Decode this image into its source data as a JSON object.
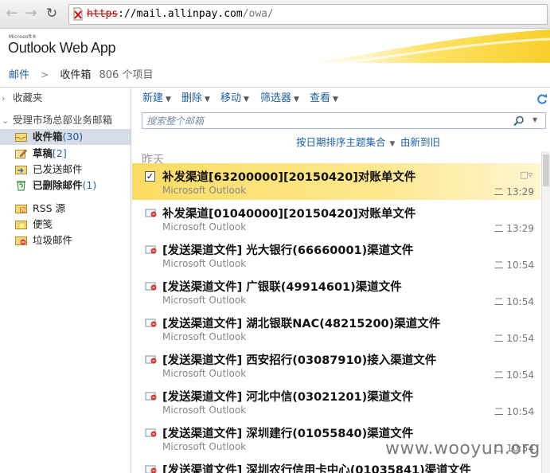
{
  "browser": {
    "url_scheme": "https",
    "url_host": "://mail.allinpay.com",
    "url_path": "/owa/"
  },
  "header": {
    "brand_small": "Microsoft®",
    "brand": "Outlook Web App"
  },
  "breadcrumb": {
    "root": "邮件",
    "current": "收件箱",
    "count": "806 个项目"
  },
  "nav": {
    "favorites": "收藏夹",
    "mailbox": "受理市场总部业务邮箱",
    "folders": [
      {
        "name": "收件箱",
        "count": "(30)"
      },
      {
        "name": "草稿",
        "count": "[2]"
      },
      {
        "name": "已发送邮件",
        "count": ""
      },
      {
        "name": "已删除邮件",
        "count": "(1)"
      },
      {
        "name": "RSS 源",
        "count": ""
      },
      {
        "name": "便笺",
        "count": ""
      },
      {
        "name": "垃圾邮件",
        "count": ""
      }
    ]
  },
  "toolbar": {
    "new": "新建",
    "delete": "删除",
    "move": "移动",
    "filter": "筛选器",
    "view": "查看"
  },
  "search": {
    "placeholder": "搜索整个邮箱"
  },
  "sort": {
    "arrange": "按日期排序主题集合",
    "order": "由新到旧"
  },
  "list": {
    "group": "昨天",
    "messages": [
      {
        "subject": "补发渠道[63200000][20150420]对账单文件",
        "sender": "Microsoft Outlook",
        "time": "二 13:29",
        "selected": true
      },
      {
        "subject": "补发渠道[01040000][20150420]对账单文件",
        "sender": "Microsoft Outlook",
        "time": "二 13:29"
      },
      {
        "subject": "[发送渠道文件] 光大银行(66660001)渠道文件",
        "sender": "Microsoft Outlook",
        "time": "二 10:54"
      },
      {
        "subject": "[发送渠道文件] 广银联(49914601)渠道文件",
        "sender": "Microsoft Outlook",
        "time": "二 10:54"
      },
      {
        "subject": "[发送渠道文件] 湖北银联NAC(48215200)渠道文件",
        "sender": "Microsoft Outlook",
        "time": "二 10:54"
      },
      {
        "subject": "[发送渠道文件] 西安招行(03087910)接入渠道文件",
        "sender": "Microsoft Outlook",
        "time": "二 10:54"
      },
      {
        "subject": "[发送渠道文件] 河北中信(03021201)渠道文件",
        "sender": "Microsoft Outlook",
        "time": "二 10:54"
      },
      {
        "subject": "[发送渠道文件] 深圳建行(01055840)渠道文件",
        "sender": "Microsoft Outlook",
        "time": "二 10:54"
      },
      {
        "subject": "[发送渠道文件] 深圳农行信用卡中心(01035841)渠道文件",
        "sender": "",
        "time": ""
      }
    ]
  },
  "watermark": "www.wooyun.org",
  "colors": {
    "link": "#1f5fa8",
    "selected_row": "#fbdc63",
    "nav_selected": "#d6dde6"
  }
}
